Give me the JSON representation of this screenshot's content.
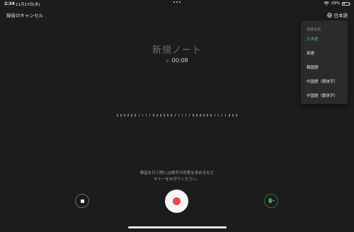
{
  "status_bar": {
    "time": "2:34",
    "date": "11月17日(木)",
    "battery_percent": "29%",
    "battery_level": 0.29
  },
  "header": {
    "cancel_label": "録音のキャンセル",
    "language_label": "日本語"
  },
  "recording": {
    "title": "新規ノート",
    "pause_glyph": "॥",
    "timer": "00:08"
  },
  "notice": {
    "line1": "録音を行う際には相手の同意を求めるなど",
    "line2": "マナーをお守りください。"
  },
  "language_menu": {
    "header": "認識言語",
    "items": [
      {
        "label": "日本語",
        "selected": true
      },
      {
        "label": "英語",
        "selected": false
      },
      {
        "label": "韓国語",
        "selected": false
      },
      {
        "label": "中国語（簡体字）",
        "selected": false
      },
      {
        "label": "中国語（繁体字）",
        "selected": false
      }
    ]
  },
  "colors": {
    "background": "#1c1c1c",
    "accent_green": "#45c46b",
    "record_red": "#e5484d"
  },
  "icons": {
    "globe": "globe-icon",
    "stop": "stop-icon",
    "record": "record-icon",
    "bookmark": "bookmark-add-icon",
    "wifi": "wifi-icon",
    "battery": "battery-icon"
  }
}
